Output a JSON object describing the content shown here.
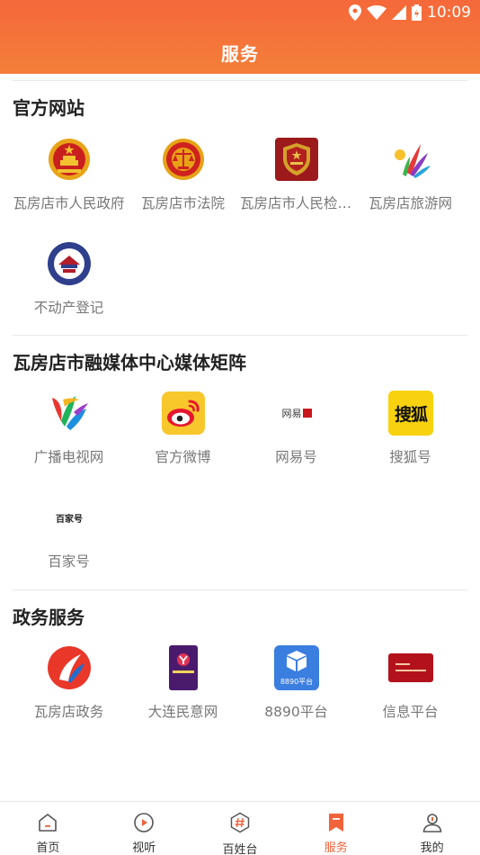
{
  "status": {
    "time": "10:09"
  },
  "header": {
    "title": "服务"
  },
  "sections": [
    {
      "title": "官方网站",
      "items": [
        {
          "label": "瓦房店市人民政府",
          "icon": "national-emblem-icon"
        },
        {
          "label": "瓦房店市法院",
          "icon": "court-emblem-icon"
        },
        {
          "label": "瓦房店市人民检察院",
          "icon": "procuratorate-emblem-icon"
        },
        {
          "label": "瓦房店旅游网",
          "icon": "tourism-logo-icon"
        },
        {
          "label": "不动产登记",
          "icon": "real-estate-registration-icon"
        }
      ]
    },
    {
      "title": "瓦房店市融媒体中心媒体矩阵",
      "items": [
        {
          "label": "广播电视网",
          "icon": "broadcast-tv-logo-icon"
        },
        {
          "label": "官方微博",
          "icon": "weibo-icon"
        },
        {
          "label": "网易号",
          "icon": "netease-logo-icon",
          "logo_text": "网易"
        },
        {
          "label": "搜狐号",
          "icon": "sohu-logo-icon",
          "logo_text": "搜狐"
        },
        {
          "label": "百家号",
          "icon": "baijiahao-logo-icon",
          "logo_text": "百家号"
        }
      ]
    },
    {
      "title": "政务服务",
      "items": [
        {
          "label": "瓦房店政务",
          "icon": "government-affairs-icon"
        },
        {
          "label": "大连民意网",
          "icon": "dalian-public-opinion-icon"
        },
        {
          "label": "8890平台",
          "icon": "8890-platform-icon",
          "logo_text": "8890平台"
        },
        {
          "label": "信息平台",
          "icon": "info-platform-icon"
        }
      ]
    }
  ],
  "bottom_nav": [
    {
      "label": "首页",
      "icon": "home-icon",
      "active": false
    },
    {
      "label": "视听",
      "icon": "play-icon",
      "active": false
    },
    {
      "label": "百姓台",
      "icon": "hashtag-icon",
      "active": false
    },
    {
      "label": "服务",
      "icon": "bookmark-icon",
      "active": true
    },
    {
      "label": "我的",
      "icon": "user-icon",
      "active": false
    }
  ],
  "colors": {
    "accent": "#f0633b",
    "header_start": "#f5683a",
    "header_end": "#f47f3a"
  }
}
